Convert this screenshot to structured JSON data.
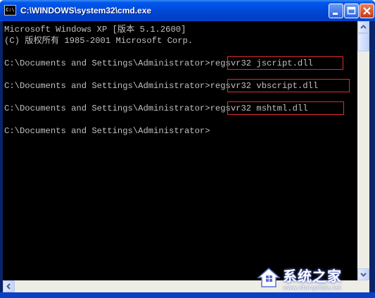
{
  "window": {
    "title": "C:\\WINDOWS\\system32\\cmd.exe",
    "icon": "cmd-icon",
    "icon_label": "C:\\",
    "controls": [
      "minimize-icon",
      "maximize-icon",
      "close-icon"
    ]
  },
  "console": {
    "banner_line1": "Microsoft Windows XP [版本 5.1.2600]",
    "banner_line2": "(C) 版权所有 1985-2001 Microsoft Corp.",
    "prompt": "C:\\Documents and Settings\\Administrator>",
    "commands": [
      "regsvr32 jscript.dll",
      "regsvr32 vbscript.dll",
      "regsvr32 mshtml.dll"
    ],
    "highlight_color": "#e22a2a"
  },
  "watermark": {
    "text": "系统之家",
    "url": "www.xitongzhijia.net"
  }
}
